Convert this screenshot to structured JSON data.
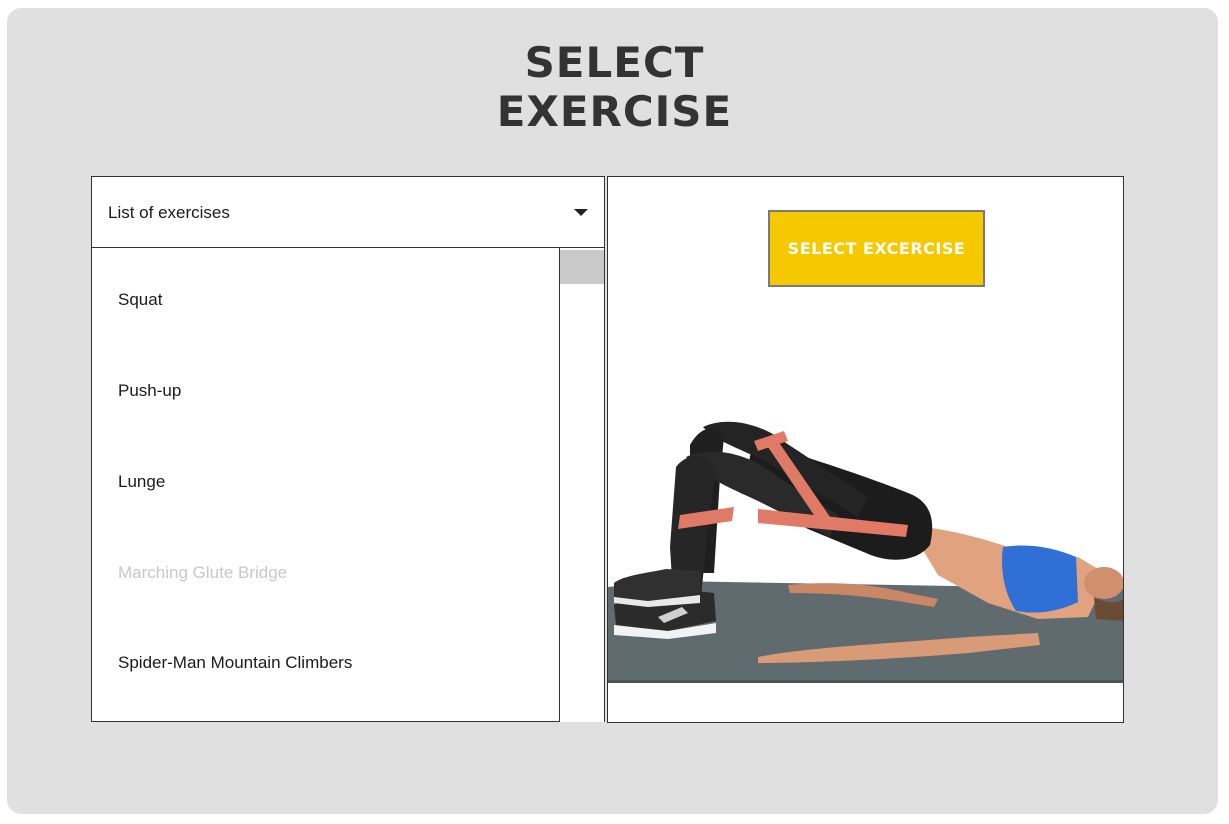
{
  "page": {
    "title_line1": "SELECT",
    "title_line2": "EXERCISE"
  },
  "dropdown": {
    "header_label": "List of exercises",
    "items": [
      {
        "label": "Squat",
        "enabled": true
      },
      {
        "label": "Push-up",
        "enabled": true
      },
      {
        "label": "Lunge",
        "enabled": true
      },
      {
        "label": "Marching Glute Bridge",
        "enabled": false
      },
      {
        "label": "Spider-Man Mountain Climbers",
        "enabled": true
      }
    ]
  },
  "preview": {
    "button_label": "SELECT EXCERCISE",
    "image_icon": "glute-bridge-exercise-image"
  },
  "colors": {
    "background_panel": "#e0e0e0",
    "accent_button": "#f5c800",
    "disabled_text": "#c8c8c8"
  }
}
